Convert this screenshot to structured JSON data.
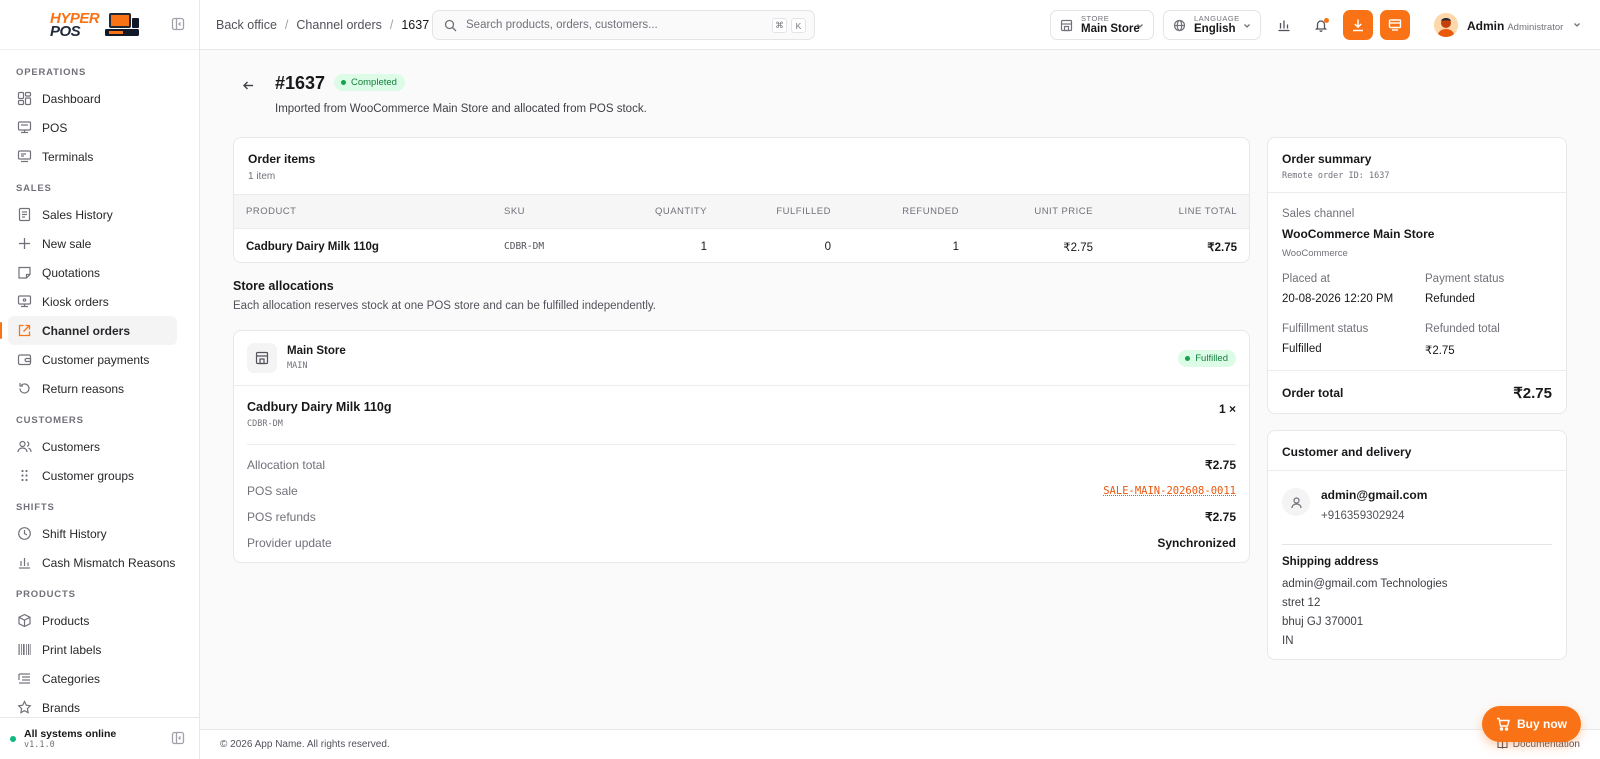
{
  "app": {
    "logo_top": "HYPER",
    "logo_bottom": "POS",
    "status_text": "All systems online",
    "version": "v1.1.0"
  },
  "sidebar": {
    "sections": [
      {
        "title": "OPERATIONS",
        "items": [
          {
            "label": "Dashboard",
            "icon": "dashboard-icon"
          },
          {
            "label": "POS",
            "icon": "monitor-icon"
          },
          {
            "label": "Terminals",
            "icon": "terminal-icon"
          }
        ]
      },
      {
        "title": "SALES",
        "items": [
          {
            "label": "Sales History",
            "icon": "receipt-icon"
          },
          {
            "label": "New sale",
            "icon": "plus-icon"
          },
          {
            "label": "Quotations",
            "icon": "note-icon"
          },
          {
            "label": "Kiosk orders",
            "icon": "kiosk-icon"
          },
          {
            "label": "Channel orders",
            "icon": "external-link-icon",
            "active": true
          },
          {
            "label": "Customer payments",
            "icon": "wallet-icon"
          },
          {
            "label": "Return reasons",
            "icon": "return-icon"
          }
        ]
      },
      {
        "title": "CUSTOMERS",
        "items": [
          {
            "label": "Customers",
            "icon": "users-icon"
          },
          {
            "label": "Customer groups",
            "icon": "grip-icon"
          }
        ]
      },
      {
        "title": "SHIFTS",
        "items": [
          {
            "label": "Shift History",
            "icon": "clock-icon"
          },
          {
            "label": "Cash Mismatch Reasons",
            "icon": "bar-chart-icon"
          }
        ]
      },
      {
        "title": "PRODUCTS",
        "items": [
          {
            "label": "Products",
            "icon": "box-icon"
          },
          {
            "label": "Print labels",
            "icon": "barcode-icon"
          },
          {
            "label": "Categories",
            "icon": "list-icon"
          },
          {
            "label": "Brands",
            "icon": "star-icon"
          }
        ]
      }
    ]
  },
  "header": {
    "breadcrumb": [
      "Back office",
      "Channel orders",
      "1637"
    ],
    "search_placeholder": "Search products, orders, customers...",
    "kbd_1": "⌘",
    "kbd_2": "K",
    "store_label": "STORE",
    "store_value": "Main Store",
    "language_label": "LANGUAGE",
    "language_value": "English",
    "user_name": "Admin",
    "user_role": "Administrator"
  },
  "order": {
    "title": "#1637",
    "status": "Completed",
    "subtitle": "Imported from WooCommerce Main Store and allocated from POS stock."
  },
  "items_card": {
    "title": "Order items",
    "count": "1 item",
    "columns": [
      "PRODUCT",
      "SKU",
      "QUANTITY",
      "FULFILLED",
      "REFUNDED",
      "UNIT PRICE",
      "LINE TOTAL"
    ],
    "rows": [
      {
        "product": "Cadbury Dairy Milk 110g",
        "sku": "CDBR-DM",
        "quantity": "1",
        "fulfilled": "0",
        "refunded": "1",
        "unit_price": "₹2.75",
        "line_total": "₹2.75"
      }
    ]
  },
  "allocations": {
    "title": "Store allocations",
    "subtitle": "Each allocation reserves stock at one POS store and can be fulfilled independently.",
    "store_name": "Main Store",
    "store_code": "MAIN",
    "status": "Fulfilled",
    "item_name": "Cadbury Dairy Milk 110g",
    "item_sku": "CDBR-DM",
    "item_qty": "1 ×",
    "rows": [
      {
        "key": "Allocation total",
        "value": "₹2.75"
      },
      {
        "key": "POS sale",
        "value": "SALE-MAIN-202608-0011"
      },
      {
        "key": "POS refunds",
        "value": "₹2.75"
      },
      {
        "key": "Provider update",
        "value": "Synchronized"
      }
    ]
  },
  "summary": {
    "title": "Order summary",
    "remote_id": "Remote order ID: 1637",
    "channel_label": "Sales channel",
    "channel_value": "WooCommerce Main Store",
    "channel_provider": "WooCommerce",
    "placed_label": "Placed at",
    "placed_value": "20-08-2026 12:20 PM",
    "payment_label": "Payment status",
    "payment_value": "Refunded",
    "fulfillment_label": "Fulfillment status",
    "fulfillment_value": "Fulfilled",
    "refunded_label": "Refunded total",
    "refunded_value": "₹2.75",
    "total_label": "Order total",
    "total_value": "₹2.75"
  },
  "customer": {
    "title": "Customer and delivery",
    "email": "admin@gmail.com",
    "phone": "+916359302924",
    "shipping_title": "Shipping address",
    "address": [
      "admin@gmail.com Technologies",
      "stret 12",
      "bhuj GJ 370001",
      "IN"
    ]
  },
  "footer": {
    "copyright": "© 2026 App Name. All rights reserved.",
    "docs": "Documentation",
    "buy_now": "Buy now"
  },
  "colors": {
    "accent": "#f97316",
    "success_bg": "#dcfce7",
    "success_fg": "#15803d"
  }
}
